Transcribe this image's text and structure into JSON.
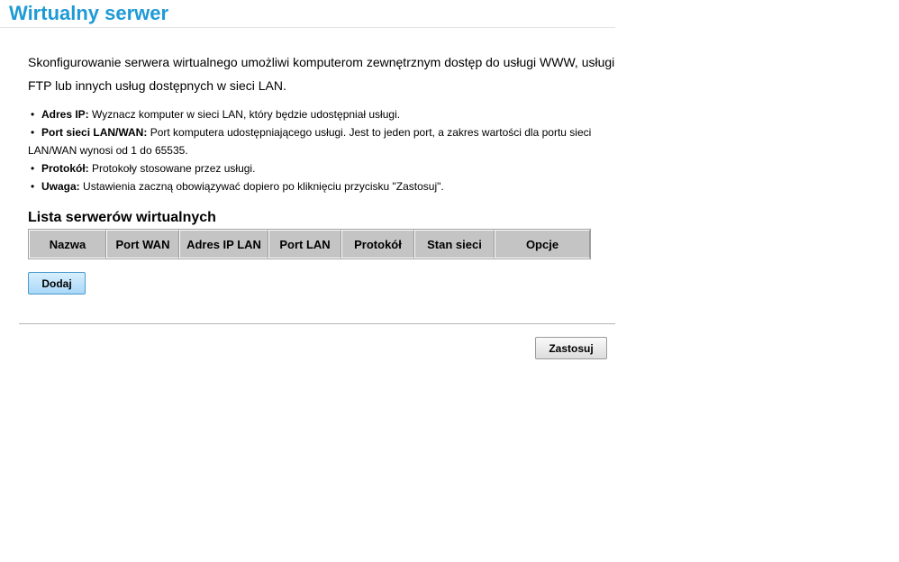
{
  "header": {
    "title": "Wirtualny serwer"
  },
  "intro": {
    "text": "Skonfigurowanie serwera wirtualnego umożliwi komputerom zewnętrznym dostęp do usługi WWW, usługi FTP lub innych usług dostępnych w sieci LAN."
  },
  "bullets": [
    {
      "label": "Adres IP:",
      "text": " Wyznacz komputer w sieci LAN, który będzie udostępniał usługi."
    },
    {
      "label": "Port sieci LAN/WAN:",
      "text": " Port komputera udostępniającego usługi. Jest to jeden port, a zakres wartości dla portu sieci",
      "cont": "LAN/WAN wynosi od 1 do 65535."
    },
    {
      "label": "Protokół:",
      "text": " Protokoły stosowane przez usługi."
    },
    {
      "label": "Uwaga:",
      "text": " Ustawienia zaczną obowiązywać dopiero po kliknięciu przycisku \"Zastosuj\"."
    }
  ],
  "table": {
    "title": "Lista serwerów wirtualnych",
    "columns": [
      "Nazwa",
      "Port WAN",
      "Adres IP LAN",
      "Port LAN",
      "Protokół",
      "Stan sieci",
      "Opcje"
    ]
  },
  "buttons": {
    "add": "Dodaj",
    "apply": "Zastosuj"
  },
  "colors": {
    "title": "#1e9ad6",
    "table_header": "#c4c4c4",
    "add_button": "#a8d8f8"
  }
}
